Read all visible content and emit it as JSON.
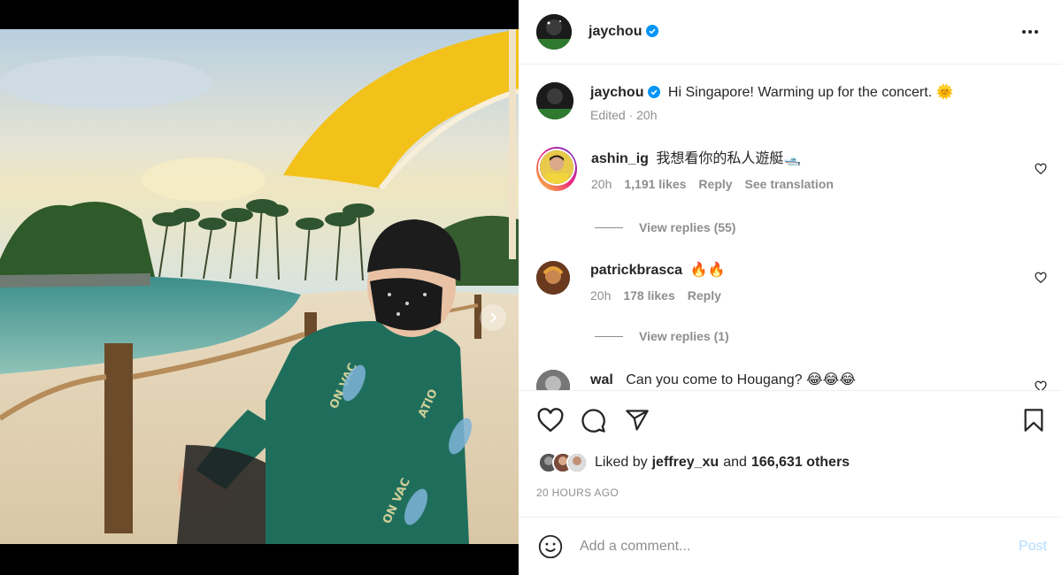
{
  "post": {
    "author": "jaychou",
    "caption": "Hi Singapore! Warming up for the concert. 🌞",
    "edited_time": "Edited · 20h"
  },
  "carousel": {
    "active_index": 1,
    "count": 3
  },
  "comments": [
    {
      "username": "ashin_ig",
      "text": "我想看你的私人遊艇🛥️",
      "time": "20h",
      "likes": "1,191 likes",
      "reply": "Reply",
      "translate": "See translation",
      "view_replies": "View replies (55)"
    },
    {
      "username": "patrickbrasca",
      "text": "🔥🔥",
      "time": "20h",
      "likes": "178 likes",
      "reply": "Reply",
      "view_replies": "View replies (1)"
    },
    {
      "username": "wal",
      "text": "Can you come to Hougang? 😂😂😂"
    }
  ],
  "likes": {
    "prefix": "Liked by",
    "user": "jeffrey_xu",
    "and": "and",
    "others": "166,631 others"
  },
  "timestamp": "20 HOURS AGO",
  "add_comment": {
    "placeholder": "Add a comment...",
    "post_label": "Post"
  },
  "colors": {
    "verified": "#0095f6",
    "post_disabled": "#b3dbff",
    "muted": "#8e8e8e"
  },
  "icons": [
    "verified-badge-icon",
    "more-options-icon",
    "heart-icon",
    "comment-icon",
    "share-icon",
    "bookmark-icon",
    "emoji-icon",
    "carousel-next-icon"
  ]
}
